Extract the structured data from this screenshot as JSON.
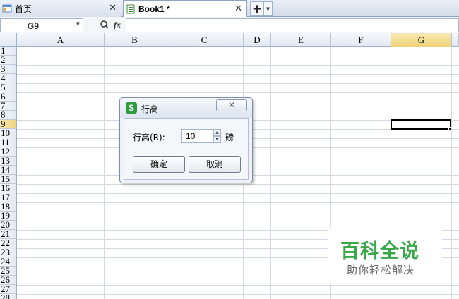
{
  "tabs": {
    "home": {
      "label": "首页",
      "close": "✕"
    },
    "book": {
      "label": "Book1 *",
      "close": "✕"
    },
    "new_tab": "+",
    "new_tab_dropdown": "▼"
  },
  "formula_bar": {
    "name_box": "G9",
    "name_box_arrow": "▼",
    "zoom_icon": "🔍",
    "fx": "fx",
    "formula": ""
  },
  "columns": [
    {
      "label": "A",
      "selected": false
    },
    {
      "label": "B",
      "selected": false
    },
    {
      "label": "C",
      "selected": false
    },
    {
      "label": "D",
      "selected": false
    },
    {
      "label": "E",
      "selected": false
    },
    {
      "label": "F",
      "selected": false
    },
    {
      "label": "G",
      "selected": true
    }
  ],
  "rows": [
    "1",
    "2",
    "3",
    "4",
    "5",
    "6",
    "7",
    "8",
    "9",
    "10",
    "11",
    "12",
    "13",
    "14",
    "15",
    "16",
    "17",
    "18",
    "19",
    "20",
    "21",
    "22",
    "23",
    "24",
    "25",
    "26",
    "27",
    "28"
  ],
  "selected_row": "9",
  "active_cell": "G9",
  "dialog": {
    "app_icon_letter": "S",
    "title": "行高",
    "close": "✕",
    "field_label": "行高(R):",
    "field_value": "10",
    "spin_up": "▲",
    "spin_down": "▼",
    "unit": "磅",
    "ok_label": "确定",
    "cancel_label": "取消"
  },
  "watermark": {
    "title": "百科全说",
    "subtitle": "助你轻松解决"
  },
  "colors": {
    "accent_green": "#3aa84a",
    "selected_header": "#efd37a",
    "header_bg": "#e2e9f3"
  }
}
